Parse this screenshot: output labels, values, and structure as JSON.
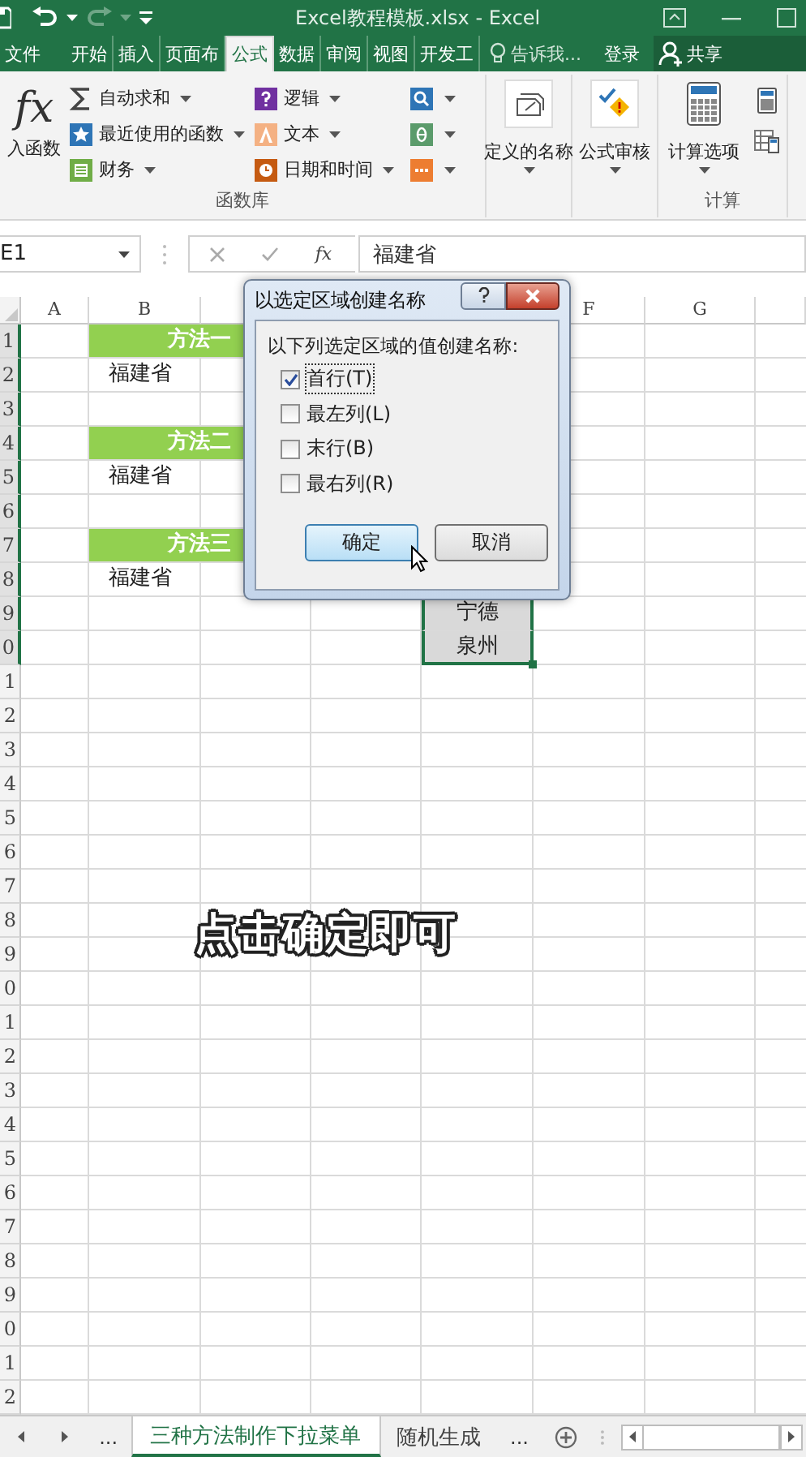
{
  "window": {
    "title": "Excel教程模板.xlsx - Excel"
  },
  "ribbon_tabs": [
    {
      "label": "文件",
      "selected": false
    },
    {
      "label": "开始",
      "selected": false
    },
    {
      "label": "插入",
      "selected": false
    },
    {
      "label": "页面布",
      "selected": false
    },
    {
      "label": "公式",
      "selected": true
    },
    {
      "label": "数据",
      "selected": false
    },
    {
      "label": "审阅",
      "selected": false
    },
    {
      "label": "视图",
      "selected": false
    },
    {
      "label": "开发工",
      "selected": false
    }
  ],
  "tell_me": "告诉我...",
  "sign_in": "登录",
  "share": "共享",
  "ribbon": {
    "function_library": {
      "insert_function": {
        "symbol": "fx",
        "label": "入函数"
      },
      "columns": [
        [
          {
            "kind": "sum",
            "label": "自动求和"
          },
          {
            "kind": "recent",
            "label": "最近使用的函数"
          },
          {
            "kind": "finance",
            "label": "财务"
          }
        ],
        [
          {
            "kind": "logic",
            "label": "逻辑"
          },
          {
            "kind": "text",
            "label": "文本"
          },
          {
            "kind": "datetime",
            "label": "日期和时间"
          }
        ],
        [
          {
            "kind": "lookup"
          },
          {
            "kind": "math"
          },
          {
            "kind": "more"
          }
        ]
      ],
      "label": "函数库"
    },
    "defined_names": {
      "label": "定义的名称"
    },
    "formula_auditing": {
      "label": "公式审核"
    },
    "calculation": {
      "options": "计算选项",
      "label": "计算"
    }
  },
  "formula_bar": {
    "name_box": "E1",
    "function_symbol": "fx",
    "value": "福建省"
  },
  "column_headers": {
    "A": "A",
    "B": "B",
    "F": "F",
    "G": "G"
  },
  "rows": [
    {
      "label": "1",
      "highlighted": true,
      "cells": {
        "B": {
          "kind": "header",
          "text": "方法一",
          "selected": false
        }
      }
    },
    {
      "label": "2",
      "highlighted": true,
      "cells": {
        "B": {
          "kind": "value",
          "text": "福建省",
          "selected": false
        }
      }
    },
    {
      "label": "3",
      "highlighted": true
    },
    {
      "label": "4",
      "highlighted": true,
      "cells": {
        "B": {
          "kind": "header",
          "text": "方法二",
          "selected": false
        }
      }
    },
    {
      "label": "5",
      "highlighted": true,
      "cells": {
        "B": {
          "kind": "value",
          "text": "福建省",
          "selected": false
        }
      }
    },
    {
      "label": "6",
      "highlighted": true
    },
    {
      "label": "7",
      "highlighted": true,
      "cells": {
        "B": {
          "kind": "header",
          "text": "方法三",
          "selected": false
        }
      }
    },
    {
      "label": "8",
      "highlighted": true,
      "cells": {
        "B": {
          "kind": "value",
          "text": "福建省",
          "selected": false
        }
      }
    },
    {
      "label": "9",
      "highlighted": true,
      "cells": {
        "E": {
          "kind": "value",
          "text": "宁德",
          "selected": true
        }
      }
    },
    {
      "label": "0",
      "highlighted": true,
      "cells": {
        "E": {
          "kind": "value",
          "text": "泉州",
          "selected": true
        }
      }
    },
    {
      "label": "1",
      "highlighted": false
    },
    {
      "label": "2",
      "highlighted": false
    },
    {
      "label": "3",
      "highlighted": false
    },
    {
      "label": "4",
      "highlighted": false
    },
    {
      "label": "5",
      "highlighted": false
    },
    {
      "label": "6",
      "highlighted": false
    },
    {
      "label": "7",
      "highlighted": false
    },
    {
      "label": "8",
      "highlighted": false
    },
    {
      "label": "9",
      "highlighted": false
    },
    {
      "label": "0",
      "highlighted": false
    },
    {
      "label": "1",
      "highlighted": false
    },
    {
      "label": "2",
      "highlighted": false
    },
    {
      "label": "3",
      "highlighted": false
    },
    {
      "label": "4",
      "highlighted": false
    },
    {
      "label": "5",
      "highlighted": false
    },
    {
      "label": "6",
      "highlighted": false
    },
    {
      "label": "7",
      "highlighted": false
    },
    {
      "label": "8",
      "highlighted": false
    },
    {
      "label": "9",
      "highlighted": false
    },
    {
      "label": "0",
      "highlighted": false
    },
    {
      "label": "1",
      "highlighted": false
    },
    {
      "label": "2",
      "highlighted": false
    }
  ],
  "dialog": {
    "title": "以选定区域创建名称",
    "group_label": "以下列选定区域的值创建名称:",
    "options": [
      {
        "label": "首行(T)",
        "checked": true
      },
      {
        "label": "最左列(L)",
        "checked": false
      },
      {
        "label": "末行(B)",
        "checked": false
      },
      {
        "label": "最右列(R)",
        "checked": false
      }
    ],
    "buttons": [
      {
        "label": "确定",
        "default": true
      },
      {
        "label": "取消",
        "default": false
      }
    ]
  },
  "caption": "点击确定即可",
  "sheet_tabs": [
    {
      "label": "三种方法制作下拉菜单",
      "selected": true
    },
    {
      "label": "随机生成",
      "selected": false
    }
  ],
  "sheet_nav": {
    "more_left": "...",
    "more_right": "..."
  }
}
